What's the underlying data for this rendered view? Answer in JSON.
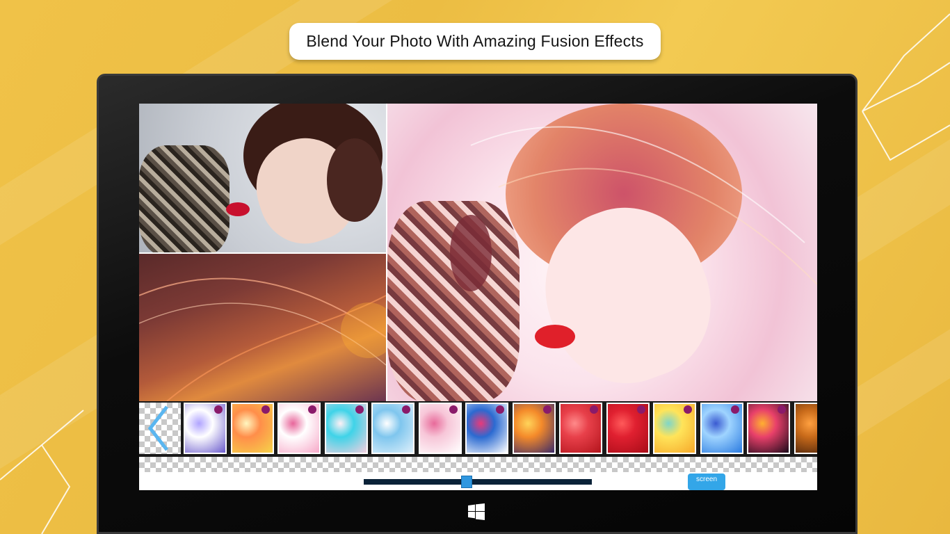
{
  "banner": {
    "text": "Blend Your Photo With Amazing Fusion Effects"
  },
  "editor": {
    "texture_thumbnails": [
      {
        "name": "purple-floral-texture",
        "colors": [
          "#6a5acd",
          "#ffffff",
          "#b0a4ff"
        ]
      },
      {
        "name": "yellow-bokeh-texture",
        "colors": [
          "#f5d44a",
          "#ff8e4a",
          "#fff7c0"
        ]
      },
      {
        "name": "pink-flowers-texture",
        "colors": [
          "#f7a8c8",
          "#ffffff",
          "#e8659a"
        ]
      },
      {
        "name": "cyan-pink-splash-texture",
        "colors": [
          "#f6d0e0",
          "#3fd3e8",
          "#fff0f5"
        ]
      },
      {
        "name": "blue-watercolor-texture",
        "colors": [
          "#dff0fb",
          "#7fc6ee",
          "#ffffff"
        ]
      },
      {
        "name": "pink-blossom-texture",
        "colors": [
          "#ffffff",
          "#f7c6d8",
          "#e86a9a"
        ]
      },
      {
        "name": "colorful-flowers-texture",
        "colors": [
          "#ffffff",
          "#2b6ad1",
          "#e83a7a"
        ]
      },
      {
        "name": "fire-abstract-texture",
        "colors": [
          "#3a2a6a",
          "#f48a2a",
          "#ffd45a"
        ]
      },
      {
        "name": "red-bokeh-texture",
        "colors": [
          "#b3141c",
          "#e8404a",
          "#ff8a8a"
        ]
      },
      {
        "name": "red-hearts-texture",
        "colors": [
          "#a80c18",
          "#e02030",
          "#ff5a5a"
        ]
      },
      {
        "name": "sunflower-texture",
        "colors": [
          "#f6a82a",
          "#ffe45a",
          "#7fd6c8"
        ]
      },
      {
        "name": "blue-flower-sky-texture",
        "colors": [
          "#2a7ae0",
          "#9fd4ff",
          "#3a5ad1"
        ]
      },
      {
        "name": "neon-swirl-texture",
        "colors": [
          "#1a0a1a",
          "#e8406a",
          "#ffb030"
        ]
      },
      {
        "name": "amber-swirl-texture",
        "colors": [
          "#3a1a0a",
          "#c86a1a",
          "#ffa040"
        ]
      }
    ],
    "opacity_slider": {
      "value_fraction": 0.45
    },
    "screen_button": {
      "label": "screen"
    }
  },
  "colors": {
    "background": "#f0c248",
    "accent_blue": "#33a6e8",
    "lip_red": "#c8102e"
  }
}
